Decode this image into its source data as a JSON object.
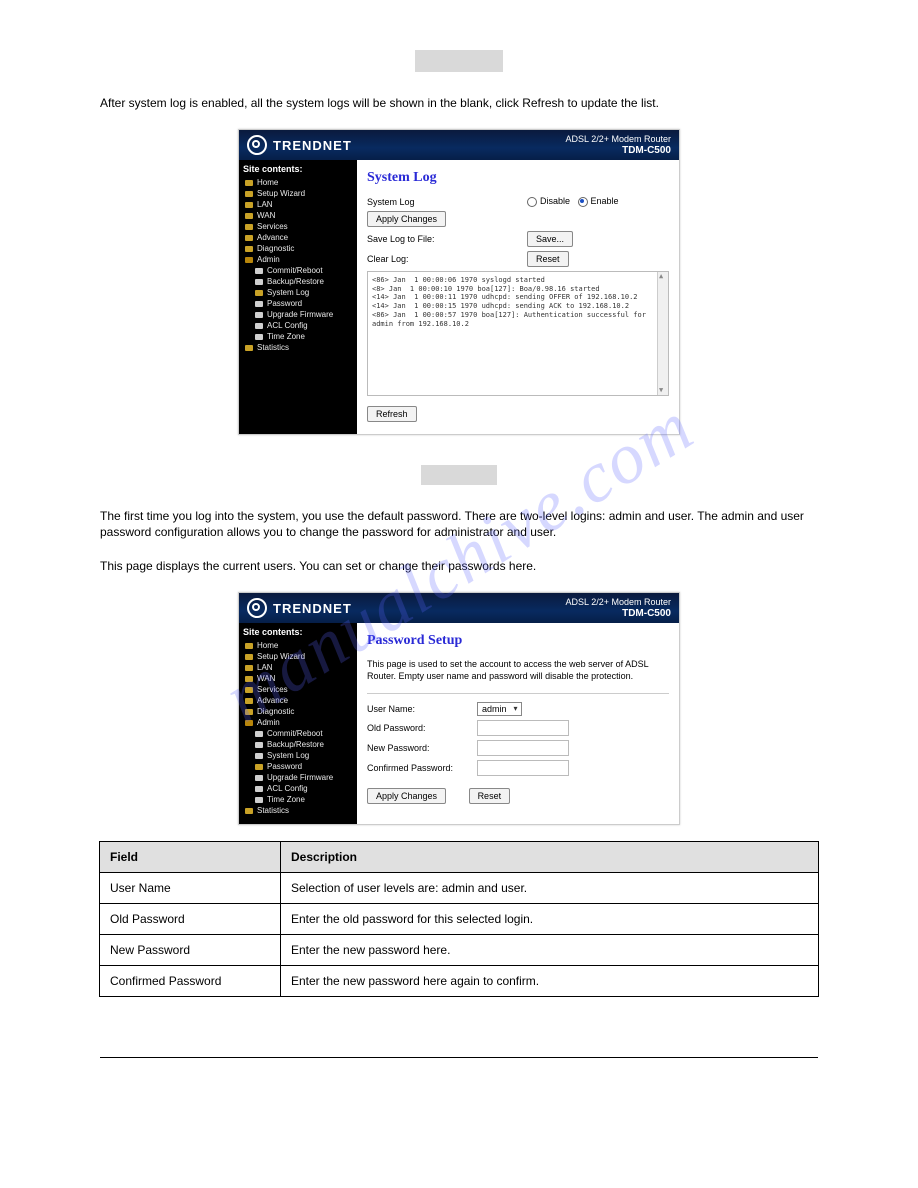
{
  "watermark": "manualchive.com",
  "redact_sections": {
    "a": " ",
    "b": " "
  },
  "text_blocks": {
    "after_apply": "After system log is enabled, all the system logs will be shown in the blank, click Refresh to update the list.",
    "password_intro_1": "The first time you log into the system, you use the default password. There are two-level logins: admin and user. The admin and user password configuration allows you to change the password for administrator and user.",
    "password_intro_2": "This page displays the current users. You can set or change their passwords here."
  },
  "shot1": {
    "brand": "TRENDNET",
    "title_line1": "ADSL 2/2+ Modem Router",
    "title_line2": "TDM-C500",
    "side_header": "Site contents:",
    "nav": [
      "Home",
      "Setup Wizard",
      "LAN",
      "WAN",
      "Services",
      "Advance",
      "Diagnostic",
      "Admin"
    ],
    "nav_sub": [
      "Commit/Reboot",
      "Backup/Restore",
      "System Log",
      "Password",
      "Upgrade Firmware",
      "ACL Config",
      "Time Zone"
    ],
    "nav_tail": [
      "Statistics"
    ],
    "h1": "System Log",
    "row_syslog": "System Log",
    "radio_disable": "Disable",
    "radio_enable": "Enable",
    "btn_apply": "Apply Changes",
    "row_save": "Save Log to File:",
    "btn_save": "Save...",
    "row_clear": "Clear Log:",
    "btn_reset": "Reset",
    "log_text": "<86> Jan  1 00:00:06 1970 syslogd started\n<8> Jan  1 00:00:10 1970 boa[127]: Boa/0.98.16 started\n<14> Jan  1 00:00:11 1970 udhcpd: sending OFFER of 192.168.10.2\n<14> Jan  1 00:00:15 1970 udhcpd: sending ACK to 192.168.10.2\n<86> Jan  1 00:00:57 1970 boa[127]: Authentication successful for admin from 192.168.10.2",
    "btn_refresh": "Refresh"
  },
  "shot2": {
    "brand": "TRENDNET",
    "title_line1": "ADSL 2/2+ Modem Router",
    "title_line2": "TDM-C500",
    "side_header": "Site contents:",
    "nav": [
      "Home",
      "Setup Wizard",
      "LAN",
      "WAN",
      "Services",
      "Advance",
      "Diagnostic",
      "Admin"
    ],
    "nav_sub": [
      "Commit/Reboot",
      "Backup/Restore",
      "System Log",
      "Password",
      "Upgrade Firmware",
      "ACL Config",
      "Time Zone"
    ],
    "nav_tail": [
      "Statistics"
    ],
    "h1": "Password Setup",
    "desc": "This page is used to set the account to access the web server of ADSL Router. Empty user name and password will disable the protection.",
    "lbl_user": "User Name:",
    "sel_user": "admin",
    "lbl_old": "Old Password:",
    "lbl_new": "New Password:",
    "lbl_conf": "Confirmed Password:",
    "btn_apply": "Apply Changes",
    "btn_reset": "Reset"
  },
  "table": {
    "h_field": "Field",
    "h_desc": "Description",
    "rows": [
      {
        "f": "User Name",
        "d": "Selection of user levels are: admin and user."
      },
      {
        "f": "Old Password",
        "d": "Enter the old password for this selected login."
      },
      {
        "f": "New Password",
        "d": "Enter the new password here."
      },
      {
        "f": "Confirmed Password",
        "d": "Enter the new password here again to confirm."
      }
    ]
  },
  "footer": {
    "left": "",
    "right": ""
  }
}
